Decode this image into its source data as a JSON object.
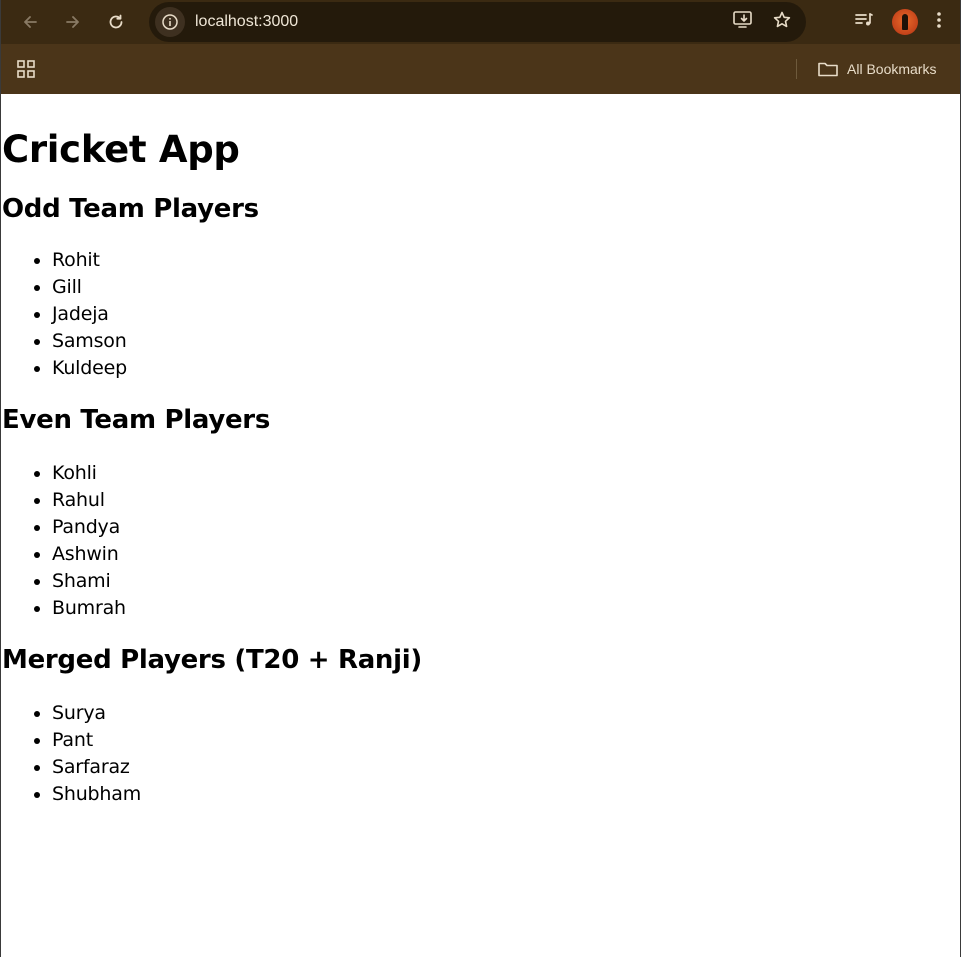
{
  "browser": {
    "url": "localhost:3000",
    "bookmarks_label": "All Bookmarks",
    "theme_color": "#3b2a12"
  },
  "page": {
    "title": "Cricket App",
    "sections": [
      {
        "heading": "Odd Team Players",
        "players": [
          "Rohit",
          "Gill",
          "Jadeja",
          "Samson",
          "Kuldeep"
        ]
      },
      {
        "heading": "Even Team Players",
        "players": [
          "Kohli",
          "Rahul",
          "Pandya",
          "Ashwin",
          "Shami",
          "Bumrah"
        ]
      },
      {
        "heading": "Merged Players (T20 + Ranji)",
        "players": [
          "Surya",
          "Pant",
          "Sarfaraz",
          "Shubham"
        ]
      }
    ]
  }
}
